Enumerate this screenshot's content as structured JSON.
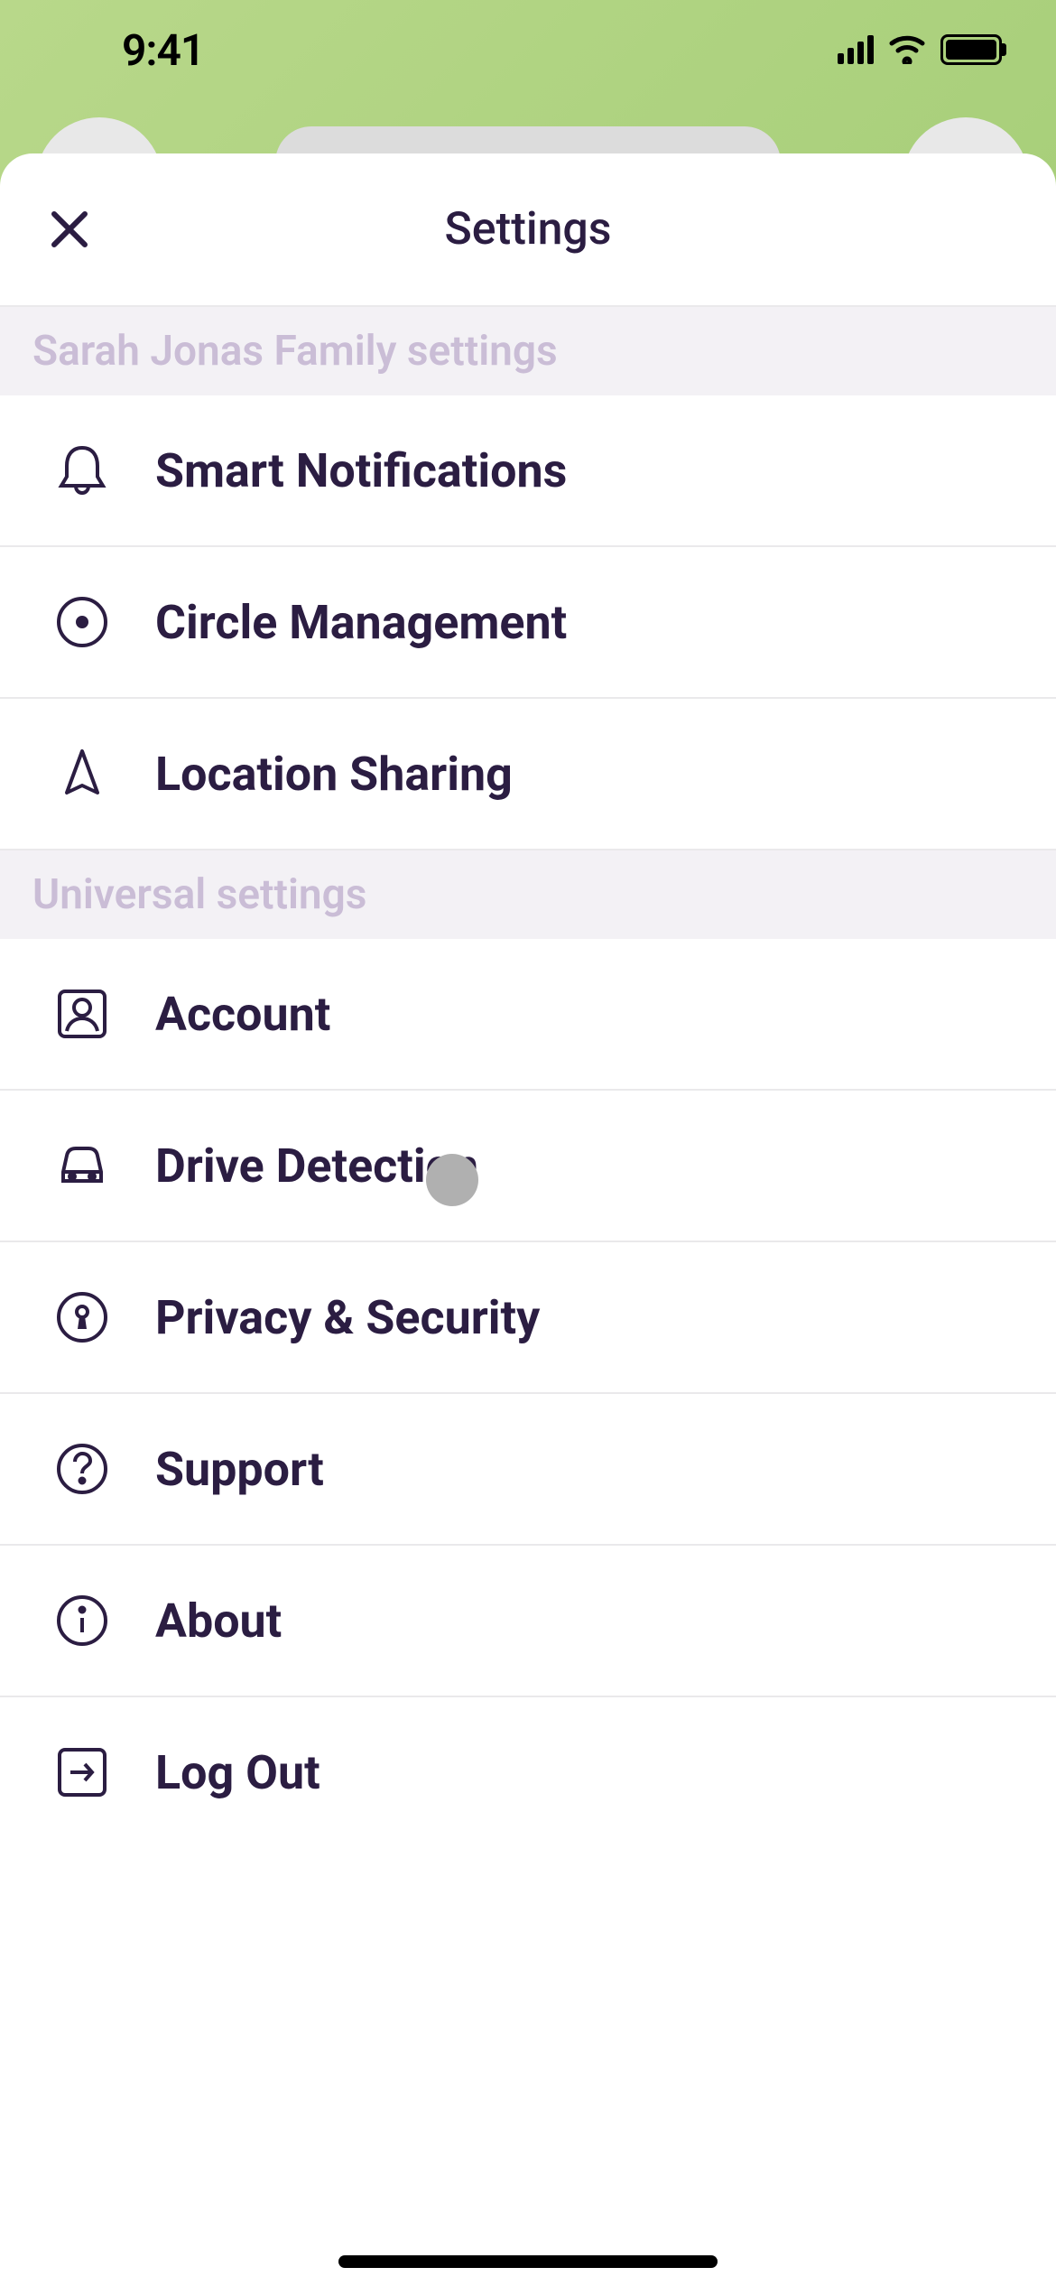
{
  "statusBar": {
    "time": "9:41"
  },
  "header": {
    "title": "Settings"
  },
  "sections": {
    "family": {
      "title": "Sarah Jonas Family settings",
      "items": {
        "smartNotifications": "Smart Notifications",
        "circleManagement": "Circle Management",
        "locationSharing": "Location Sharing"
      }
    },
    "universal": {
      "title": "Universal settings",
      "items": {
        "account": "Account",
        "driveDetection": "Drive Detection",
        "privacySecurity": "Privacy & Security",
        "support": "Support",
        "about": "About",
        "logOut": "Log Out"
      }
    }
  }
}
